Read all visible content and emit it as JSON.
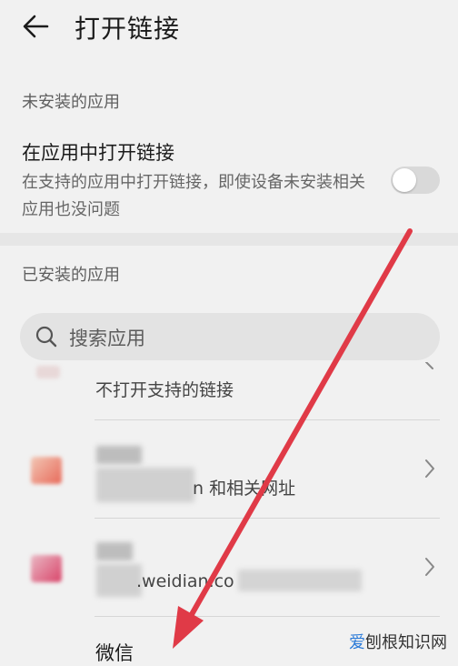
{
  "header": {
    "title": "打开链接",
    "back_icon": "arrow-left-icon"
  },
  "not_installed": {
    "section_label": "未安装的应用",
    "item_title": "在应用中打开链接",
    "item_desc": "在支持的应用中打开链接，即使设备未安装相关应用也没问题",
    "toggle_on": false
  },
  "installed": {
    "section_label": "已安装的应用",
    "search_placeholder": "搜索应用",
    "apps": [
      {
        "subtitle": "不打开支持的链接"
      },
      {
        "subtitle_suffix": "n 和相关网址"
      },
      {
        "subtitle_suffix": ".weidian.co"
      },
      {
        "name": "微信"
      }
    ]
  },
  "watermark": {
    "brand": "爱",
    "text": "刨根知识网"
  },
  "colors": {
    "background": "#f1f1f1",
    "arrow": "#e03a47",
    "watermark_accent": "#2a7ad8"
  }
}
